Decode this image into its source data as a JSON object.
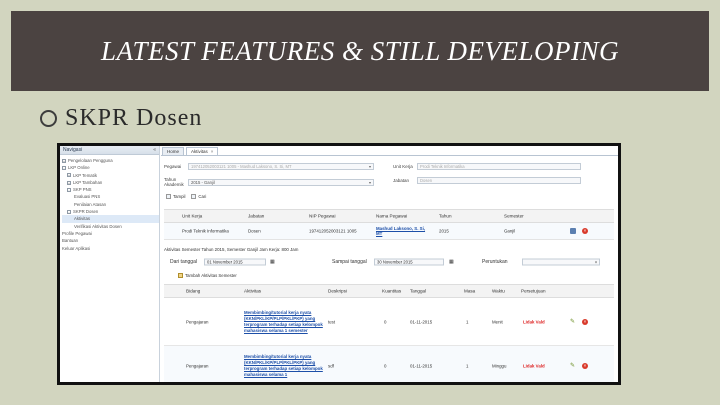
{
  "slide": {
    "title": "LATEST FEATURES & STILL DEVELOPING",
    "bullet": "SKPR Dosen"
  },
  "nav": {
    "title": "Navigasi",
    "items": [
      {
        "label": "Pengelolaan Pengguna"
      },
      {
        "label": "LKP Online"
      },
      {
        "label": "LKP Tematik"
      },
      {
        "label": "LKP Tambahan"
      },
      {
        "label": "SKP PNS"
      },
      {
        "label": "Evaluasi PNS"
      },
      {
        "label": "Penilaian Atasan"
      },
      {
        "label": "SKPR Dosen"
      },
      {
        "label": "Aktivitas"
      },
      {
        "label": "Verifikasi Aktivitas Dosen"
      },
      {
        "label": "Profile Pegawai"
      },
      {
        "label": "Bantuan"
      },
      {
        "label": "Keluar Aplikasi"
      }
    ]
  },
  "tabs": [
    {
      "label": "Home"
    },
    {
      "label": "Aktivitas"
    }
  ],
  "form": {
    "pegawai_label": "Pegawai",
    "pegawai_value": "197412052003121 1005 - Mashud Laksono, S. Si, MT",
    "tahun_label": "Tahun Akademik",
    "tahun_value": "2015 - Ganjil",
    "unit_label": "Unit Kerja",
    "unit_value": "Prodi Teknik Informatika",
    "jabatan_label": "Jabatan",
    "jabatan_value": "Dosen"
  },
  "buttons": {
    "tampil": "Tampil",
    "cari": "Cari"
  },
  "grid1": {
    "headers": [
      "Unit Kerja",
      "Jabatan",
      "NIP Pegawai",
      "Nama Pegawai",
      "Tahun",
      "Semester"
    ],
    "row": [
      "Prodi Teknik Informatika",
      "Dosen",
      "197412052003121 1005",
      "Mashud Laksono, S. Si, MT",
      "2015",
      "Ganjil"
    ]
  },
  "subtitle": "Aktivitas Semester Tahun 2015, Semester Ganjil Jam Kerja: 800 Jam",
  "filter": {
    "from_label": "Dari tanggal",
    "from_value": "01 November 2015",
    "to_label": "Sampai tanggal",
    "to_value": "30 November 2015",
    "peruntukan_label": "Peruntukan",
    "peruntukan_value": ""
  },
  "add_button": "Tambah Aktivitas Semester",
  "grid2": {
    "headers": [
      "Bidang",
      "Aktivitas",
      "Deskripsi",
      "Kuantitas",
      "Tanggal",
      "Masa",
      "Waktu",
      "Persetujuan"
    ],
    "rows": [
      {
        "bidang": "Pengajaran",
        "aktivitas": "Membimbing/tutorial kerja nyata (KKN/PKL/KP/PLP/PKL/PKP) yang terprogram terhadap setiap kelompok mahasiswa selama 1 semester",
        "deskripsi": "test",
        "kuantitas": "0",
        "tanggal": "01-11-2015",
        "masa": "1",
        "waktu": "Menit",
        "persetujuan": "Lidak Vald"
      },
      {
        "bidang": "Pengajaran",
        "aktivitas": "Membimbing/tutorial kerja nyata (KKN/PKL/KP/PLP/PKL/PKP) yang terprogram terhadap setiap kelompok mahasiswa selama 1",
        "deskripsi": "sdf",
        "kuantitas": "0",
        "tanggal": "01-11-2015",
        "masa": "1",
        "waktu": "Minggu",
        "persetujuan": "Lidak Vald"
      }
    ]
  },
  "colors": {
    "banner_bg": "#4b4341",
    "slide_bg": "#d2d5bf",
    "link": "#1d4fa8",
    "reject": "#d22222"
  }
}
